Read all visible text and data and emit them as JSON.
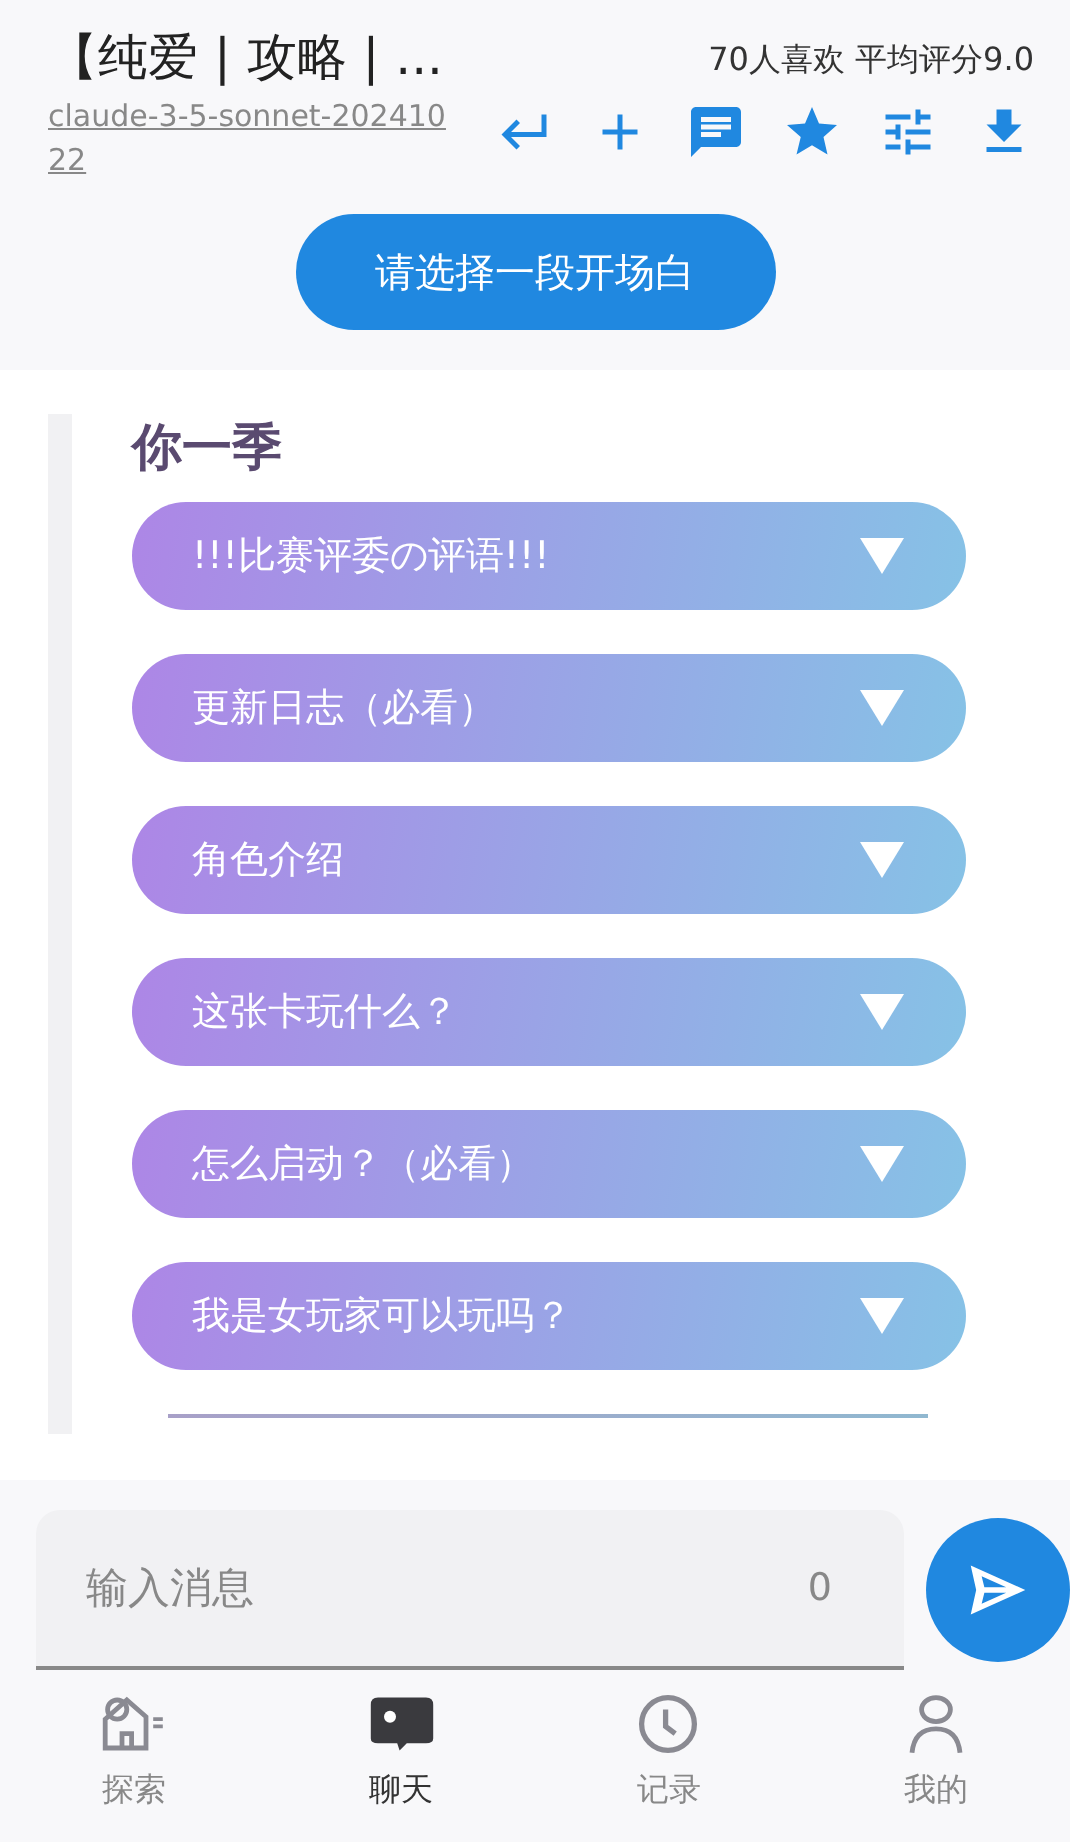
{
  "header": {
    "title": "【纯爱 | 攻略 | ...",
    "model": "claude-3-5-sonnet-20241022",
    "stats": "70人喜欢 平均评分9.0"
  },
  "opening_button": "请选择一段开场白",
  "content": {
    "heading": "你一季",
    "sections": [
      {
        "label": "!!!比赛评委の评语!!!",
        "expanded": false
      },
      {
        "label": "更新日志（必看）",
        "expanded": false
      },
      {
        "label": "角色介绍",
        "expanded": false
      },
      {
        "label": "这张卡玩什么？",
        "expanded": false
      },
      {
        "label": "怎么启动？（必看）",
        "expanded": false
      },
      {
        "label": "我是女玩家可以玩吗？",
        "expanded": false
      }
    ]
  },
  "composer": {
    "placeholder": "输入消息",
    "count": "0"
  },
  "nav": [
    {
      "label": "探索",
      "kind": "explore",
      "selected": false
    },
    {
      "label": "聊天",
      "kind": "chat",
      "selected": true
    },
    {
      "label": "记录",
      "kind": "history",
      "selected": false
    },
    {
      "label": "我的",
      "kind": "me",
      "selected": false
    }
  ]
}
